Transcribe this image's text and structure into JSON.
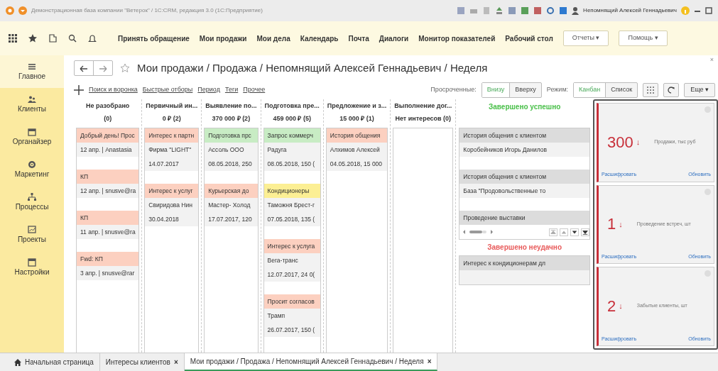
{
  "window": {
    "title": "Демонстрационная база компании \"Ветерок\" / 1С:CRM, редакция 3.0  (1С:Предприятие)",
    "user": "Непомнящий Алексей Геннадьевич"
  },
  "menu": {
    "items": [
      "Принять обращение",
      "Мои продажи",
      "Мои дела",
      "Календарь",
      "Почта",
      "Диалоги",
      "Монитор показателей",
      "Рабочий стол"
    ],
    "dropdowns": [
      {
        "label": "Отчеты",
        "caret": "▾"
      },
      {
        "label": "Помощь",
        "caret": "▾"
      }
    ]
  },
  "sidebar": {
    "items": [
      {
        "label": "Главное",
        "selected": true
      },
      {
        "label": "Клиенты",
        "selected": false
      },
      {
        "label": "Органайзер",
        "selected": false
      },
      {
        "label": "Маркетинг",
        "selected": false
      },
      {
        "label": "Процессы",
        "selected": false
      },
      {
        "label": "Проекты",
        "selected": false
      },
      {
        "label": "Настройки",
        "selected": false
      }
    ]
  },
  "header": {
    "title": "Мои продажи / Продажа / Непомнящий Алексей Геннадьевич / Неделя",
    "close": "×"
  },
  "toolbar": {
    "links": [
      "Поиск и воронка",
      "Быстрые отборы",
      "Период",
      "Теги",
      "Прочее"
    ],
    "overdue": {
      "label": "Просроченные:",
      "options": [
        {
          "label": "Внизу",
          "selected": true
        },
        {
          "label": "Вверху",
          "selected": false
        }
      ]
    },
    "mode": {
      "label": "Режим:",
      "options": [
        {
          "label": "Канбан",
          "selected": true
        },
        {
          "label": "Список",
          "selected": false
        }
      ]
    },
    "more": {
      "label": "Еще",
      "caret": "▾"
    }
  },
  "columns": [
    {
      "kind": "stage",
      "title": "Не разобрано",
      "summary": "(0)",
      "cards": [
        {
          "title": "Добрый день! Прос",
          "color": "#fcd0c0",
          "lines": [
            "12 апр. | Anastasia"
          ]
        },
        {
          "title": "КП",
          "color": "#fcd0c0",
          "lines": [
            "12 апр. | snusve@ra"
          ]
        },
        {
          "title": "КП",
          "color": "#fcd0c0",
          "lines": [
            "11 апр. | snusve@ra"
          ]
        },
        {
          "title": "Fwd: КП",
          "color": "#fcd0c0",
          "lines": [
            "3 апр. | snusve@rar"
          ]
        }
      ]
    },
    {
      "kind": "stage",
      "title": "Первичный ин...",
      "summary": "0 ₽ (2)",
      "cards": [
        {
          "title": "Интерес к партн",
          "color": "#fcd0c0",
          "lines": [
            "Фирма \"LIGHT\"",
            "14.07.2017"
          ]
        },
        {
          "title": "Интерес к услуг",
          "color": "#fcd0c0",
          "lines": [
            "Свиридова Нин",
            "30.04.2018"
          ]
        }
      ]
    },
    {
      "kind": "stage",
      "title": "Выявление по...",
      "summary": "370 000 ₽ (2)",
      "cards": [
        {
          "title": "Подготовка прс",
          "color": "#c8ecc4",
          "lines": [
            "Ассоль ООО",
            "08.05.2018, 250"
          ]
        },
        {
          "title": "Курьерская до",
          "color": "#fcd0c0",
          "lines": [
            "Мастер- Холод",
            "17.07.2017, 120"
          ]
        }
      ]
    },
    {
      "kind": "stage",
      "title": "Подготовка пре...",
      "summary": "459 000 ₽ (5)",
      "cards": [
        {
          "title": "Запрос коммерч",
          "color": "#c8ecc4",
          "lines": [
            "Радуга",
            "08.05.2018, 150 ("
          ]
        },
        {
          "title": "Кондиционеры",
          "color": "#fcef94",
          "lines": [
            "Таможня Брест-г",
            "07.05.2018, 135 ("
          ]
        },
        {
          "title": "Интерес к услуга",
          "color": "#fcd0c0",
          "lines": [
            "Вега-транс",
            "12.07.2017, 24 0("
          ]
        },
        {
          "title": "Просит согласов",
          "color": "#fcd0c0",
          "lines": [
            "Трамп",
            "26.07.2017, 150 ("
          ]
        }
      ]
    },
    {
      "kind": "stage",
      "title": "Предложение и з...",
      "summary": "15 000 ₽ (1)",
      "cards": [
        {
          "title": "История общения",
          "color": "#fcd0c0",
          "lines": [
            "Алхимов Алексей",
            "04.05.2018, 15 000"
          ]
        }
      ]
    },
    {
      "kind": "stage",
      "title": "Выполнение дог...",
      "summary": "Нет интересов (0)"
    },
    {
      "kind": "outcome",
      "sections": [
        {
          "title": "Завершено успешно",
          "kind": "success",
          "pager": true,
          "cards": [
            {
              "title": "История общения с клиентом",
              "color": "#dcdcdc",
              "lines": [
                "Коробейников Игорь Данилов"
              ]
            },
            {
              "title": "История общения с клиентом",
              "color": "#dcdcdc",
              "lines": [
                "База \"Продовольственные то"
              ]
            },
            {
              "title": "Проведение выставки",
              "color": "#dcdcdc"
            }
          ]
        },
        {
          "title": "Завершено неудачно",
          "kind": "failure",
          "pager": false,
          "cards": [
            {
              "title": "Интерес к кондиционерам дл",
              "color": "#dcdcdc"
            }
          ]
        }
      ]
    }
  ],
  "widgets": [
    {
      "value": "300",
      "trend": "↓",
      "label": "Продажи, тыс руб",
      "links": [
        "Расшифровать",
        "Обновить"
      ]
    },
    {
      "value": "1",
      "trend": "↓",
      "label": "Проведение встреч, шт",
      "links": [
        "Расшифровать",
        "Обновить"
      ]
    },
    {
      "value": "2",
      "trend": "↓",
      "label": "Забытые клиенты, шт",
      "links": [
        "Расшифровать",
        "Обновить"
      ]
    }
  ],
  "bottom_tabs": [
    {
      "label": "Начальная страница",
      "home": true,
      "close": false,
      "selected": false
    },
    {
      "label": "Интересы клиентов",
      "home": false,
      "close": true,
      "selected": false
    },
    {
      "label": "Мои продажи / Продажа / Непомнящий Алексей Геннадьевич / Неделя",
      "home": false,
      "close": true,
      "selected": true
    }
  ],
  "tab_close": "×"
}
